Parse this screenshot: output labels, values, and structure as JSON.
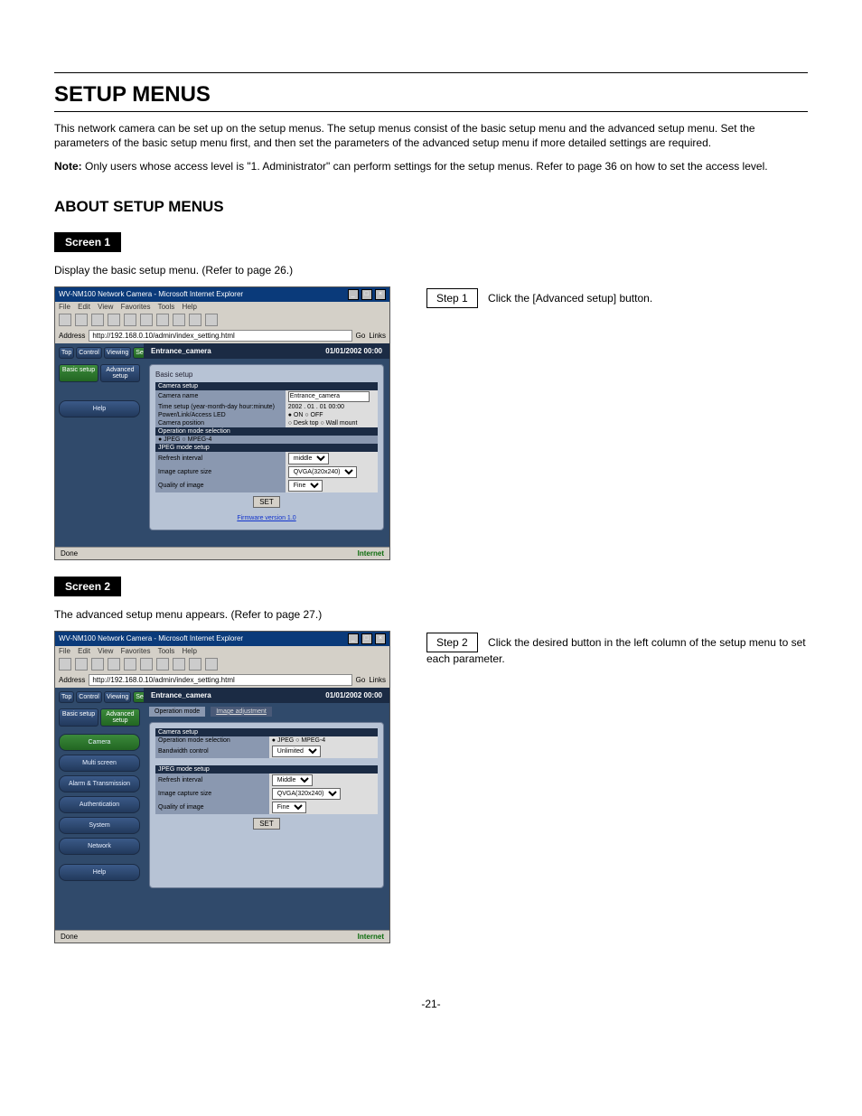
{
  "doc": {
    "heading": "SETUP MENUS",
    "intro": "This network camera can be set up on the setup menus. The setup menus consist of the basic setup menu and the advanced setup menu. Set the parameters of the basic setup menu first, and then set the parameters of the advanced setup menu if more detailed settings are required.",
    "note_label": "Note:",
    "note_text": "Only users whose access level is \"1. Administrator\" can perform settings for the setup menus. Refer to page 36 on how to set the access level.",
    "about_heading": "ABOUT SETUP MENUS",
    "screen1_label": "Screen 1",
    "screen1_desc": "Display the basic setup menu. (Refer to page 26.)",
    "step1_num": "Step 1",
    "step1_text": "Click the [Advanced setup] button.",
    "screen2_label": "Screen 2",
    "screen2_desc": "The advanced setup menu appears. (Refer to page 27.)",
    "step2_num": "Step 2",
    "step2_text": "Click the desired button in the left column of the setup menu to set each parameter.",
    "page_number": "-21-"
  },
  "shot1": {
    "window_title": "WV-NM100 Network Camera - Microsoft Internet Explorer",
    "menus": [
      "File",
      "Edit",
      "View",
      "Favorites",
      "Tools",
      "Help"
    ],
    "address_label": "Address",
    "address_value": "http://192.168.0.10/admin/index_setting.html",
    "go": "Go",
    "links": "Links",
    "nav": {
      "top": "Top",
      "control": "Control",
      "viewing": "Viewing",
      "setup": "Setup"
    },
    "subtabs": {
      "basic": "Basic setup",
      "advanced": "Advanced setup"
    },
    "sidebar": {
      "help": "Help"
    },
    "main_title": "Entrance_camera",
    "clock": "01/01/2002  00:00",
    "panel_title": "Basic setup",
    "sections": {
      "camera_setup": "Camera setup",
      "camera_name_label": "Camera name",
      "camera_name_value": "Entrance_camera",
      "time_setup_label": "Time setup (year-month-day hour:minute)",
      "time_setup_value": "2002 . 01 . 01  00:00",
      "power_led_label": "Power/Link/Access LED",
      "power_led_value": "● ON  ○ OFF",
      "camera_pos_label": "Camera position",
      "camera_pos_value": "○ Desk top  ○ Wall mount",
      "op_mode_sel": "Operation mode selection",
      "op_mode_value": "● JPEG  ○ MPEG-4",
      "jpeg_mode_setup": "JPEG mode setup",
      "refresh_label": "Refresh interval",
      "refresh_value": "middle",
      "capture_label": "Image capture size",
      "capture_value": "QVGA(320x240)",
      "quality_label": "Quality of image",
      "quality_value": "Fine"
    },
    "set_button": "SET",
    "firmware": "Firmware version 1.0",
    "status_left": "Done",
    "status_right": "Internet"
  },
  "shot2": {
    "window_title": "WV-NM100 Network Camera - Microsoft Internet Explorer",
    "menus": [
      "File",
      "Edit",
      "View",
      "Favorites",
      "Tools",
      "Help"
    ],
    "address_label": "Address",
    "address_value": "http://192.168.0.10/admin/index_setting.html",
    "go": "Go",
    "links": "Links",
    "nav": {
      "top": "Top",
      "control": "Control",
      "viewing": "Viewing",
      "setup": "Setup"
    },
    "subtabs": {
      "basic": "Basic setup",
      "advanced": "Advanced setup"
    },
    "sidebar": {
      "camera": "Camera",
      "multi": "Multi screen",
      "alarm": "Alarm & Transmission",
      "auth": "Authentication",
      "system": "System",
      "network": "Network",
      "help": "Help"
    },
    "main_title": "Entrance_camera",
    "clock": "01/01/2002  00:00",
    "tabs": {
      "op": "Operation mode",
      "img": "Image adjustment"
    },
    "sections": {
      "camera_setup": "Camera setup",
      "op_mode_label": "Operation mode selection",
      "op_mode_value": "● JPEG  ○ MPEG-4",
      "bandwidth_label": "Bandwidth control",
      "bandwidth_value": "Unlimited",
      "jpeg_mode_setup": "JPEG mode setup",
      "refresh_label": "Refresh interval",
      "refresh_value": "Middle",
      "capture_label": "Image capture size",
      "capture_value": "QVGA(320x240)",
      "quality_label": "Quality of image",
      "quality_value": "Fine"
    },
    "set_button": "SET",
    "status_left": "Done",
    "status_right": "Internet"
  }
}
